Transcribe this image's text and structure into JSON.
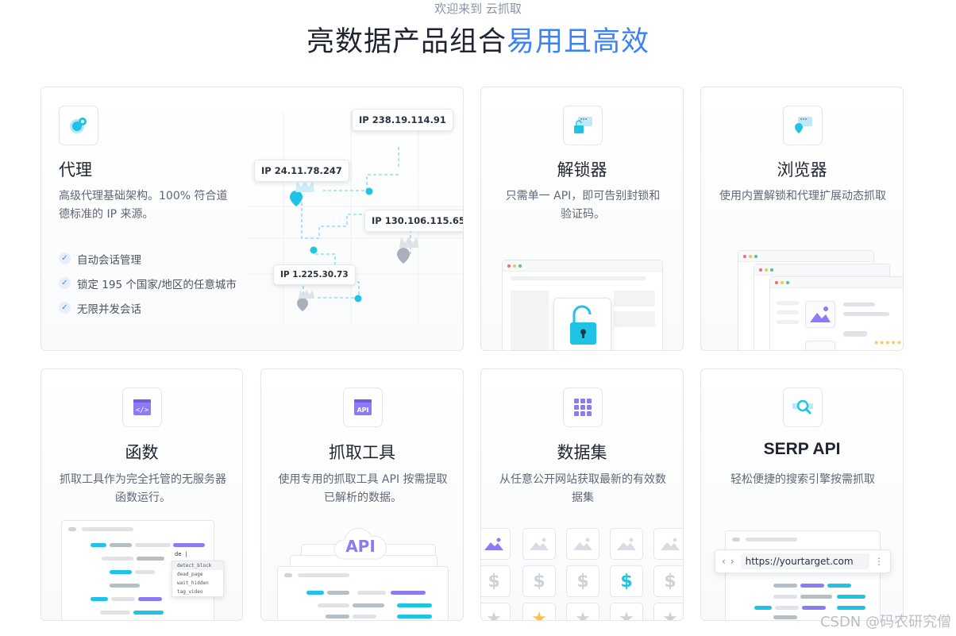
{
  "header": {
    "eyebrow": "欢迎来到 云抓取",
    "headline_main": "亮数据产品组合",
    "headline_accent": "易用且高效"
  },
  "colors": {
    "accent": "#3b82f6",
    "cyan": "#1ec3e6",
    "purple": "#8b7cf6"
  },
  "cards": {
    "proxy": {
      "icon": "globe-pin-icon",
      "title": "代理",
      "desc": "高级代理基础架构。100% 符合道德标准的 IP 来源。",
      "features": [
        "自动会话管理",
        "锁定 195 个国家/地区的任意城市",
        "无限并发会话"
      ],
      "ips": [
        "IP 238.19.114.91",
        "IP 24.11.78.247",
        "IP 130.106.115.65",
        "IP 1.225.30.73"
      ]
    },
    "unlocker": {
      "icon": "unlock-window-icon",
      "title": "解锁器",
      "desc": "只需单一 API，即可告别封锁和验证码。"
    },
    "browser": {
      "icon": "browser-pin-icon",
      "title": "浏览器",
      "desc": "使用内置解锁和代理扩展动态抓取"
    },
    "functions": {
      "icon": "code-window-icon",
      "title": "函数",
      "desc": "抓取工具作为完全托管的无服务器函数运行。",
      "autocomplete": {
        "typed": "de |",
        "options": [
          "detect_block",
          "dead_page",
          "wait_hidden",
          "tag_video"
        ]
      }
    },
    "scraper": {
      "icon": "api-window-icon",
      "title": "抓取工具",
      "desc": "使用专用的抓取工具 API 按需提取已解析的数据。",
      "cloud_label": "API"
    },
    "datasets": {
      "icon": "grid-icon",
      "title": "数据集",
      "desc": "从任意公开网站获取最新的有效数据集"
    },
    "serp": {
      "icon": "search-magnifier-icon",
      "title": "SERP API",
      "desc": "轻松便捷的搜索引擎按需抓取",
      "url": "https://yourtarget.com"
    }
  },
  "watermark": "CSDN @码农研究僧"
}
